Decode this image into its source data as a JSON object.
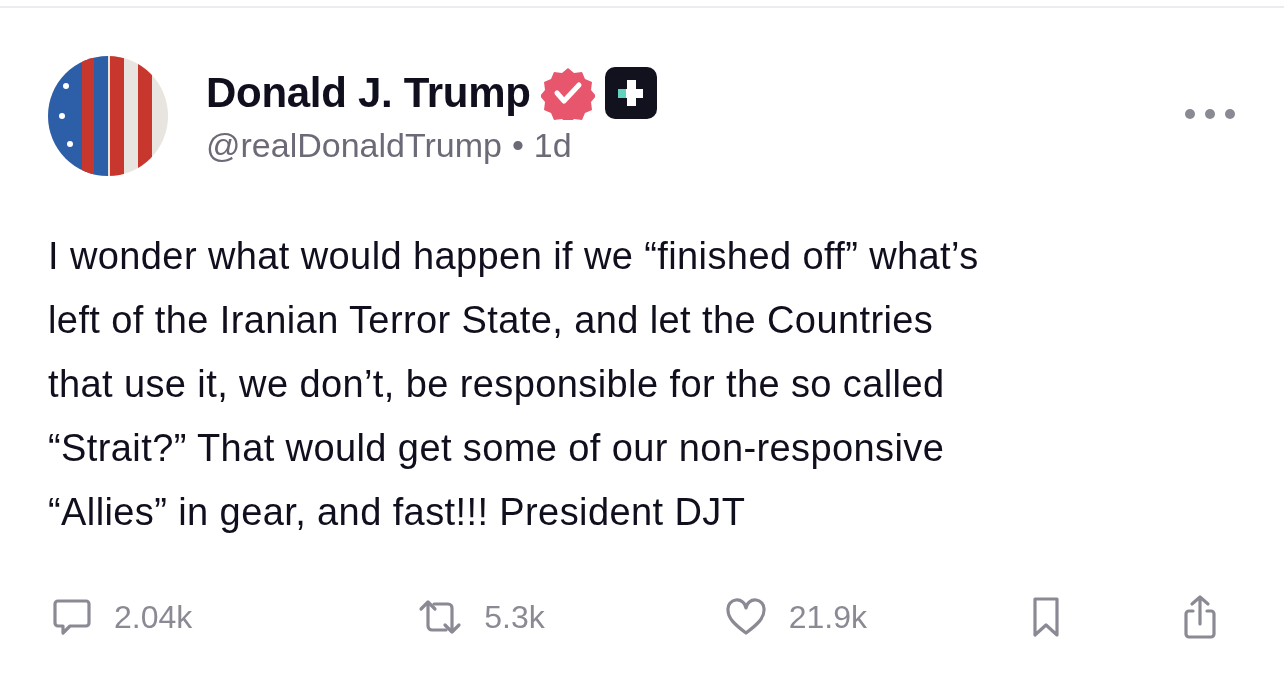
{
  "post": {
    "author": {
      "name": "Donald J. Trump",
      "verified": true,
      "handle": "@realDonaldTrump",
      "separator": "•",
      "time": "1d"
    },
    "text": "I wonder what would happen if we “finished off” what’s\nleft of the Iranian Terror State, and let the Countries\nthat use it, we don’t, be responsible for the so called\n“Strait?” That would get some of our non-responsive\n“Allies” in gear, and fast!!! President DJT",
    "actions": [
      {
        "kind": "reply",
        "count": "2.04k"
      },
      {
        "kind": "repost",
        "count": "5.3k"
      },
      {
        "kind": "like",
        "count": "21.9k"
      },
      {
        "kind": "bookmark"
      },
      {
        "kind": "share"
      }
    ]
  }
}
